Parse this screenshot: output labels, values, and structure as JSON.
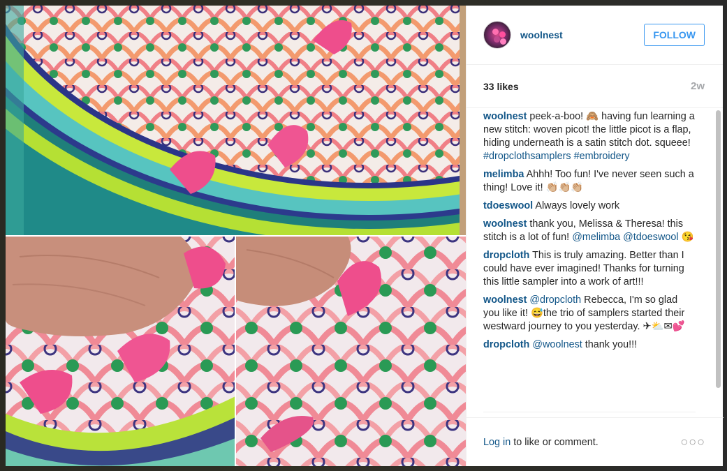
{
  "post": {
    "username": "woolnest",
    "follow_label": "FOLLOW",
    "likes": "33 likes",
    "age": "2w"
  },
  "comments": [
    {
      "user": "woolnest",
      "text": "peek-a-boo! 🙈 having fun learning a new stitch: woven picot! the little picot is a flap, hiding underneath is a satin stitch dot. squeee! ",
      "tags": "#dropclothsamplers #embroidery"
    },
    {
      "user": "melimba",
      "text": "Ahhh! Too fun! I've never seen such a thing! Love it! 👏🏼👏🏼👏🏼",
      "tags": ""
    },
    {
      "user": "tdoeswool",
      "text": "Always lovely work",
      "tags": ""
    },
    {
      "user": "woolnest",
      "text": "thank you, Melissa & Theresa! this stitch is a lot of fun! ",
      "tags": "@melimba @tdoeswool",
      "suffix": " 😘"
    },
    {
      "user": "dropcloth",
      "text": "This is truly amazing. Better than I could have ever imagined! Thanks for turning this little sampler into a work of art!!!",
      "tags": ""
    },
    {
      "user": "woolnest",
      "tags": "@dropcloth",
      "text": " Rebecca, I'm so glad you like it! 😅the trio of samplers started their westward journey to you yesterday. ✈⛅✉💕"
    },
    {
      "user": "dropcloth",
      "tags": "@woolnest",
      "text": " thank you!!!"
    }
  ],
  "footer": {
    "login_link": "Log in",
    "login_rest": " to like or comment.",
    "more_label": "○○○"
  },
  "icons": {
    "avatar": "avatar",
    "more": "more-options-icon"
  },
  "colors": {
    "link": "#125688",
    "follow": "#3897f0"
  }
}
